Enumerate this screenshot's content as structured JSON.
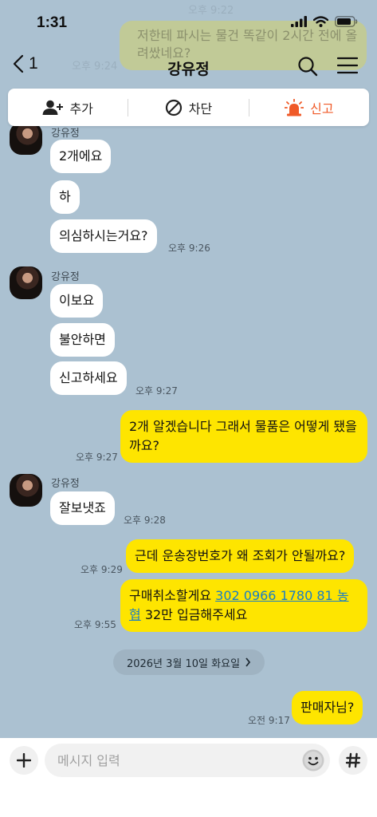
{
  "status_bar": {
    "time": "1:31"
  },
  "background_ghost": {
    "time_top": "오후 9:22",
    "time_mid": "오후 9:24",
    "text": "저한테 파시는 물건 똑같이 2시간 전에 올려쌌네요?"
  },
  "header": {
    "back_count": "1",
    "title": "강유정"
  },
  "action_bar": {
    "add_label": "추가",
    "block_label": "차단",
    "report_label": "신고"
  },
  "messages": [
    {
      "sender": "강유정",
      "text": "2개에요"
    },
    {
      "text": "하"
    },
    {
      "text": "의심하시는거요?",
      "time": "오후 9:26"
    },
    {
      "sender": "강유정",
      "text": "이보요"
    },
    {
      "text": "불안하면"
    },
    {
      "text": "신고하세요",
      "time": "오후 9:27"
    },
    {
      "text": "2개 알겠습니다 그래서 물품은 어떻게 됐을까요?",
      "time": "오후 9:27"
    },
    {
      "sender": "강유정",
      "text": "잘보냇죠",
      "time": "오후 9:28"
    },
    {
      "text": "근데 운송장번호가 왜 조회가 안될까요?",
      "time": "오후 9:29"
    },
    {
      "text_before": "구매취소할게요 ",
      "link": "302 0966 1780 81 농협",
      "text_after": " 32만 입금해주세요",
      "time": "오후 9:55"
    },
    {
      "text": "판매자님?",
      "time": "오전 9:17"
    }
  ],
  "date_divider": {
    "label": "2026년 3월 10일 화요일"
  },
  "input_bar": {
    "placeholder": "메시지 입력"
  },
  "colors": {
    "chat_background": "#abc1d1",
    "outgoing_bubble": "#fee500",
    "incoming_bubble": "#ffffff",
    "report_accent": "#f05a28",
    "link": "#1a7ec4"
  }
}
